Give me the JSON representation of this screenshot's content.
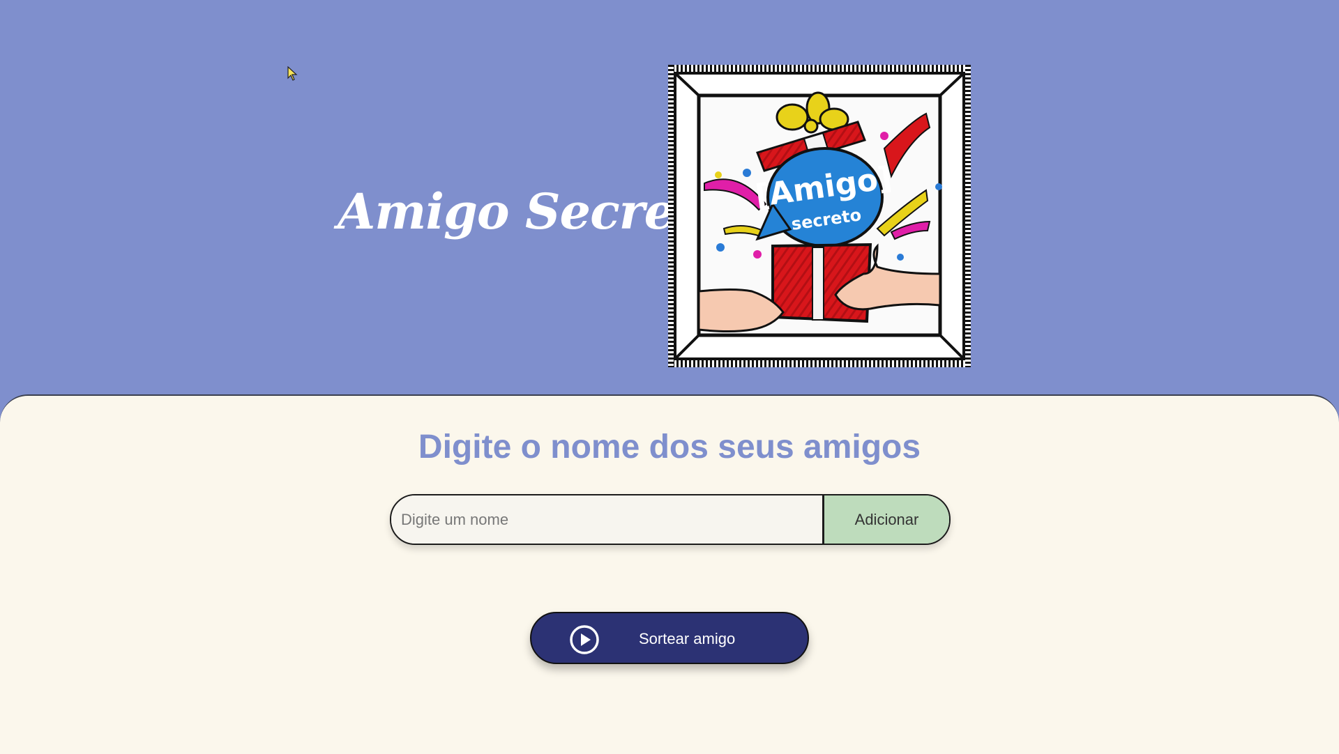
{
  "header": {
    "title": "Amigo Secreto",
    "logo": {
      "name": "amigo-secreto-logo",
      "line1": "Amigo",
      "line2": "secreto"
    }
  },
  "main": {
    "subtitle": "Digite o nome dos seus amigos",
    "input": {
      "placeholder": "Digite um nome",
      "value": ""
    },
    "add_button_label": "Adicionar",
    "draw_button": {
      "label": "Sortear amigo",
      "icon": "play-circle-icon"
    }
  },
  "colors": {
    "header_bg": "#7f8fcd",
    "main_bg": "#fbf7ec",
    "subtitle": "#7f8fcd",
    "add_button_bg": "#bedcbc",
    "draw_button_bg": "#2c3274"
  }
}
